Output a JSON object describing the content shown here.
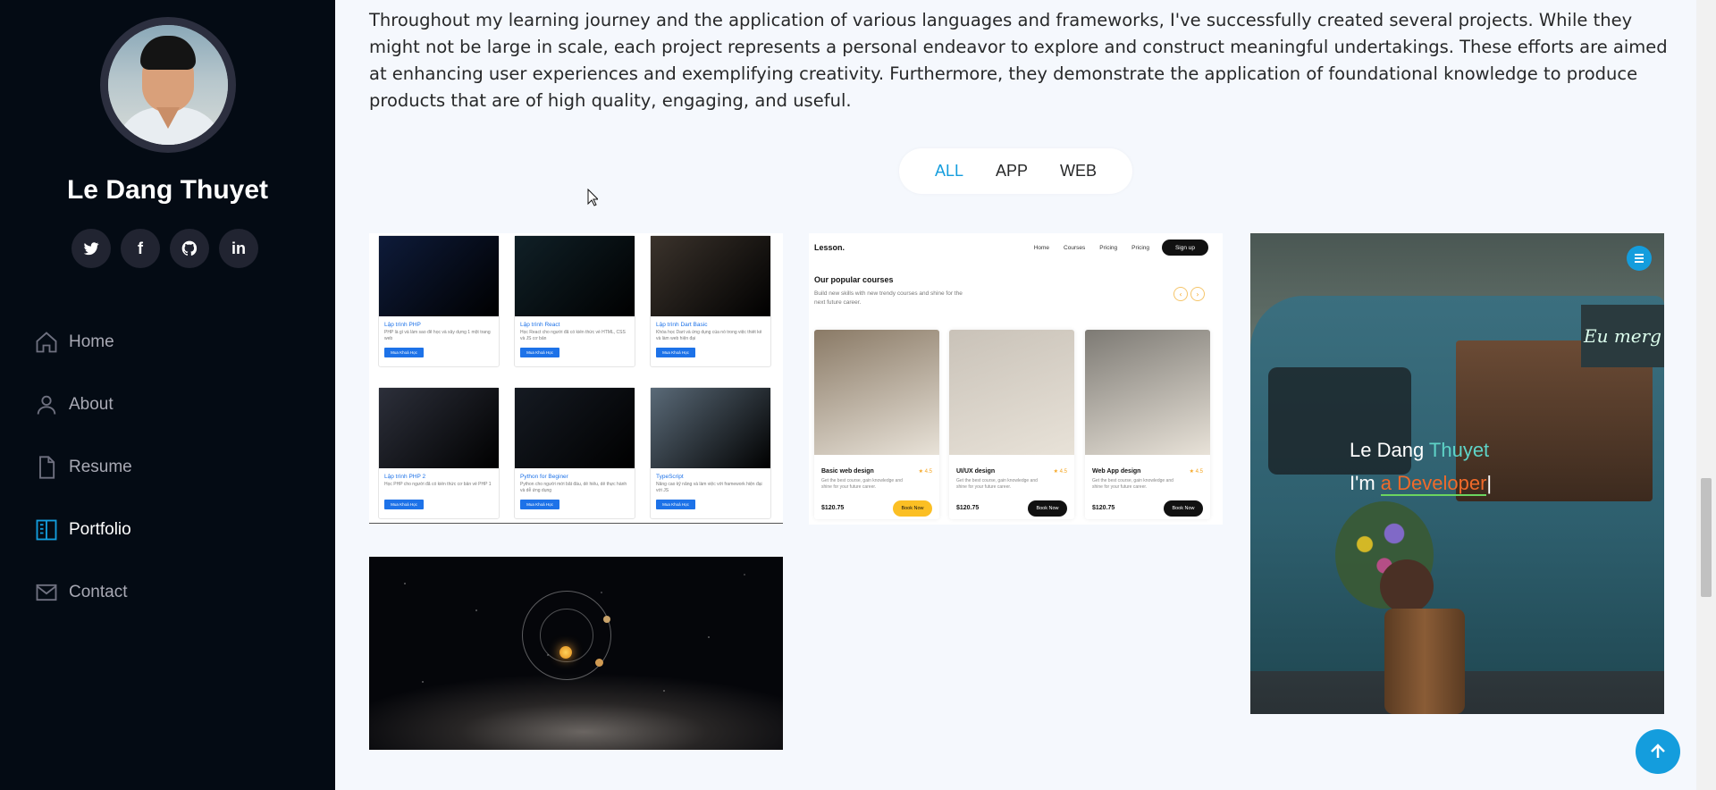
{
  "profile": {
    "name": "Le Dang Thuyet"
  },
  "social": [
    {
      "name": "twitter-icon"
    },
    {
      "name": "facebook-icon",
      "label": "f"
    },
    {
      "name": "github-icon"
    },
    {
      "name": "linkedin-icon",
      "label": "in"
    }
  ],
  "nav": [
    {
      "label": "Home",
      "icon": "home-icon"
    },
    {
      "label": "About",
      "icon": "person-icon"
    },
    {
      "label": "Resume",
      "icon": "file-icon"
    },
    {
      "label": "Portfolio",
      "icon": "book-half-icon",
      "active": true
    },
    {
      "label": "Contact",
      "icon": "envelope-icon"
    }
  ],
  "portfolio": {
    "intro": "Throughout my learning journey and the application of various languages and frameworks, I've successfully created several projects. While they might not be large in scale, each project represents a personal endeavor to explore and construct meaningful undertakings. These efforts are aimed at enhancing user experiences and exemplifying creativity. Furthermore, they demonstrate the application of foundational knowledge to produce products that are of high quality, engaging, and useful.",
    "filters": [
      "ALL",
      "APP",
      "WEB"
    ],
    "active_filter": "ALL",
    "accent_color": "#149ddd"
  },
  "courses_tile": {
    "items": [
      {
        "title": "Lập trình PHP",
        "desc": "PHP là gì và làm sao để học và xây dựng 1 một trang web",
        "btn": "Mua Khoá Học",
        "color": "#0e1b3a"
      },
      {
        "title": "Lập trình React",
        "desc": "Học React cho người đã có kiến thức về HTML, CSS và JS cơ bản",
        "btn": "Mua Khoá Học",
        "color": "#102027"
      },
      {
        "title": "Lập trình Dart Basic",
        "desc": "Khóa học Dart và ứng dụng của nó trong việc thiết kế và làm web hiện đại",
        "btn": "Mua Khoá Học",
        "color": "#3b332c"
      },
      {
        "title": "Lập trình PHP 2",
        "desc": "Học PHP cho người đã có kiến thức cơ bản về PHP 1",
        "btn": "Mua Khoá Học",
        "color": "#2c2f3a"
      },
      {
        "title": "Python for Beginer",
        "desc": "Python cho người mới bắt đầu, dễ hiểu, dễ thực hành và dễ ứng dụng",
        "btn": "Mua Khoá Học",
        "color": "#151a22"
      },
      {
        "title": "TypeScript",
        "desc": "Nâng cao kỹ năng và làm việc với framework hiện đại với JS",
        "btn": "Mua Khoá Học",
        "color": "#5a6a78"
      }
    ]
  },
  "lesson_tile": {
    "logo": "Lesson.",
    "links": [
      "Home",
      "Courses",
      "Pricing",
      "Pricing"
    ],
    "signup": "Sign up",
    "title": "Our popular courses",
    "subtitle": "Build new skills with new trendy courses and shine for the next future career.",
    "arrow_prev": "‹",
    "arrow_next": "›",
    "cards": [
      {
        "name": "Basic web design",
        "rating": "★ 4.5",
        "desc": "Get the best course, gain knowledge and shine for your future career.",
        "price": "$120.75",
        "btn": "Book Now",
        "highlight": true,
        "color": "#8a7a66"
      },
      {
        "name": "UI/UX design",
        "rating": "★ 4.5",
        "desc": "Get the best course, gain knowledge and shine for your future career.",
        "price": "$120.75",
        "btn": "Book Now",
        "highlight": false,
        "color": "#c9c2b8"
      },
      {
        "name": "Web App design",
        "rating": "★ 4.5",
        "desc": "Get the best course, gain knowledge and shine for your future career.",
        "price": "$120.75",
        "btn": "Book Now",
        "highlight": false,
        "color": "#7d7a74"
      }
    ]
  },
  "hero_tile": {
    "line1_prefix": "Le Dang ",
    "line1_highlight": "Thuyet",
    "line2_prefix": "I'm ",
    "line2_highlight": "a Developer",
    "line2_cursor": "|",
    "sign_text": "Eu merg",
    "menu_icon": "hamburger-icon"
  },
  "space_tile": {
    "theme": "solar-system"
  }
}
